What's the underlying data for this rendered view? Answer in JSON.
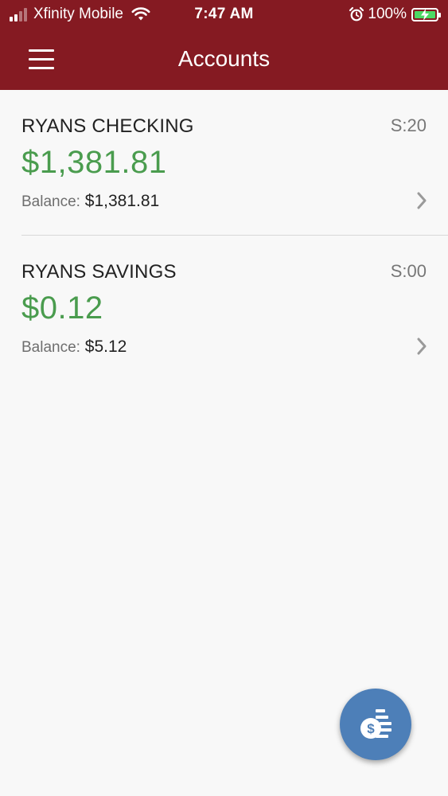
{
  "status_bar": {
    "carrier": "Xfinity Mobile",
    "time": "7:47 AM",
    "battery_percent": "100%",
    "signal_bars": 4,
    "signal_bars_active": 2,
    "icons": [
      "signal-icon",
      "wifi-icon",
      "alarm-icon",
      "battery-charging-icon"
    ]
  },
  "header": {
    "title": "Accounts",
    "menu_icon": "hamburger-menu-icon",
    "background_color": "#851a22"
  },
  "accounts": [
    {
      "name": "RYANS CHECKING",
      "status": "S:20",
      "available": "$1,381.81",
      "balance_label": "Balance:",
      "balance": "$1,381.81",
      "chevron_icon": "chevron-right-icon"
    },
    {
      "name": "RYANS SAVINGS",
      "status": "S:00",
      "available": "$0.12",
      "balance_label": "Balance:",
      "balance": "$5.12",
      "chevron_icon": "chevron-right-icon"
    }
  ],
  "fab": {
    "icon": "money-transfer-icon",
    "color": "#4d7fb8"
  },
  "colors": {
    "amount_green": "#4a9c4e",
    "page_background": "#f8f8f8"
  }
}
